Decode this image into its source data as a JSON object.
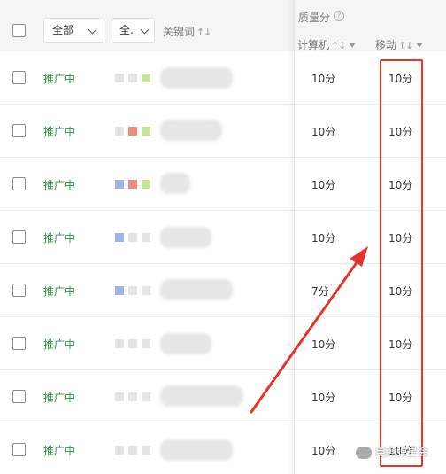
{
  "header": {
    "filter_all": "全部",
    "filter_all2": "全.",
    "keyword_label": "关键词",
    "quality_label": "质量分",
    "pc_label": "计算机",
    "mobile_label": "移动",
    "sort_glyph": "↑↓"
  },
  "rows": [
    {
      "status": "推广中",
      "pc": "10分",
      "mobile": "10分"
    },
    {
      "status": "推广中",
      "pc": "10分",
      "mobile": "10分"
    },
    {
      "status": "推广中",
      "pc": "10分",
      "mobile": "10分"
    },
    {
      "status": "推广中",
      "pc": "10分",
      "mobile": "10分"
    },
    {
      "status": "推广中",
      "pc": "7分",
      "mobile": "10分"
    },
    {
      "status": "推广中",
      "pc": "10分",
      "mobile": "10分"
    },
    {
      "status": "推广中",
      "pc": "10分",
      "mobile": "10分"
    },
    {
      "status": "推广中",
      "pc": "10分",
      "mobile": "10分"
    }
  ],
  "watermark": "电商弹星会",
  "colors": {
    "status_green": "#2e9a3e",
    "highlight_red": "#e8322c"
  }
}
